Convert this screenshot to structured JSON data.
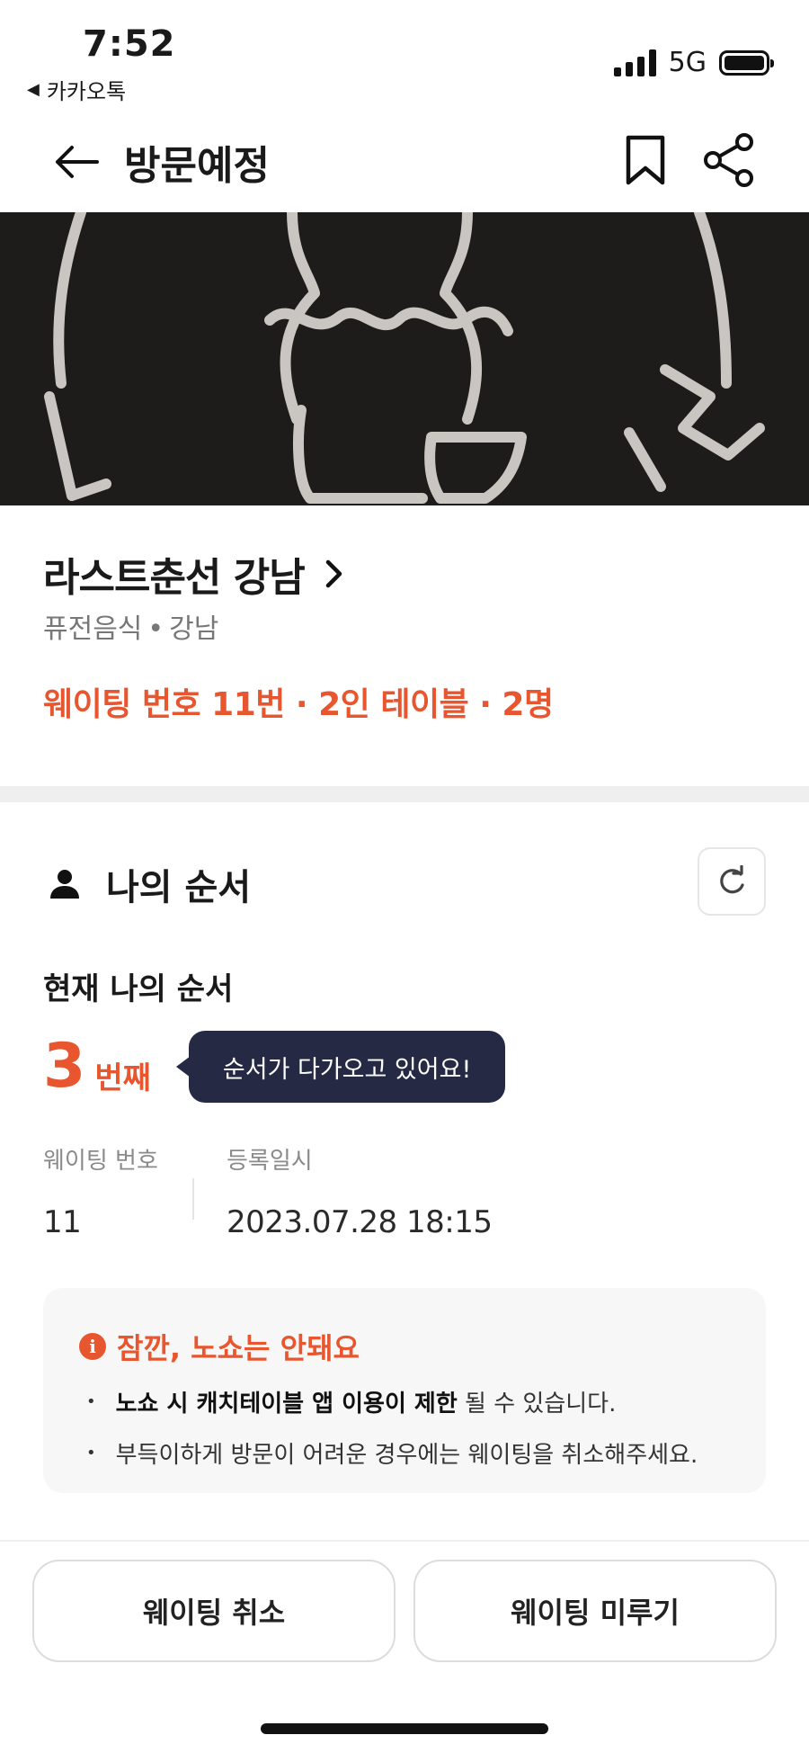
{
  "status_bar": {
    "time": "7:52",
    "back_app": "카카오톡",
    "network": "5G"
  },
  "header": {
    "title": "방문예정"
  },
  "restaurant": {
    "name": "라스트춘선 강남",
    "category": "퓨전음식",
    "area": "강남",
    "waiting_summary": "웨이팅 번호 11번 · 2인 테이블 · 2명"
  },
  "order": {
    "section_title": "나의 순서",
    "current_label": "현재 나의 순서",
    "rank": "3",
    "rank_unit": "번째",
    "bubble_text": "순서가 다가오고 있어요!",
    "waiting_number_label": "웨이팅 번호",
    "waiting_number": "11",
    "registered_label": "등록일시",
    "registered_at": "2023.07.28 18:15"
  },
  "notice": {
    "title": "잠깐, 노쇼는 안돼요",
    "item1_bold": "노쇼 시 캐치테이블 앱 이용이 제한",
    "item1_rest": " 될 수 있습니다.",
    "item2": "부득이하게 방문이 어려운 경우에는 웨이팅을 취소해주세요."
  },
  "buttons": {
    "cancel": "웨이팅 취소",
    "delay": "웨이팅 미루기"
  },
  "colors": {
    "accent": "#e8562f",
    "bubble": "#262944",
    "banner_bg": "#1d1c1a"
  }
}
